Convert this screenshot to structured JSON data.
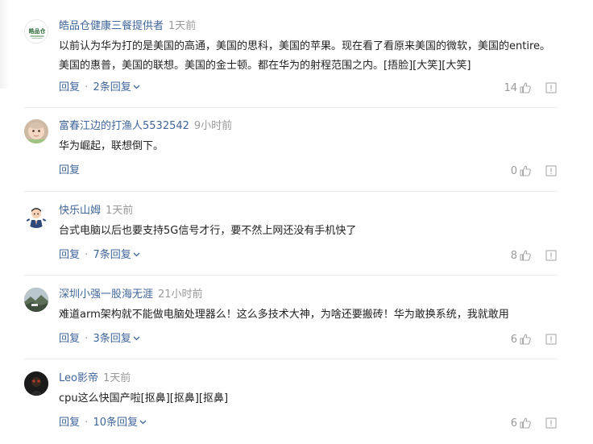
{
  "comments": [
    {
      "username": "皓品仓健康三餐提供者",
      "time": "1天前",
      "text": "以前认为华为打的是美国的高通，美国的思科，美国的苹果。现在看了看原来美国的微软，美国的entire。美国的惠普，美国的联想。美国的金士顿。都在华为的射程范围之内。[捂脸][大笑][大笑]",
      "reply_label": "回复",
      "sep": "·",
      "replies_label": "2条回复",
      "likes": "14",
      "avatar_text": "皓品仓",
      "avatar_icon": "brand-logo-avatar"
    },
    {
      "username": "富春江边的打渔人5532542",
      "time": "9小时前",
      "text": "华为崛起，联想倒下。",
      "reply_label": "回复",
      "likes": "0",
      "avatar_icon": "baby-photo-avatar"
    },
    {
      "username": "快乐山姆",
      "time": "1天前",
      "text": "台式电脑以后也要支持5G信号才行，要不然上网还没有手机快了",
      "reply_label": "回复",
      "sep": "·",
      "replies_label": "7条回复",
      "likes": "8",
      "avatar_icon": "cartoon-man-avatar"
    },
    {
      "username": "深圳小强一股海无涯",
      "time": "21小时前",
      "text": "难道arm架构就不能做电脑处理器么！这么多技术大神，为啥还要搬砖！华为敢换系统，我就敢用",
      "reply_label": "回复",
      "sep": "·",
      "replies_label": "3条回复",
      "likes": "6",
      "avatar_icon": "landscape-photo-avatar"
    },
    {
      "username": "Leo影帝",
      "time": "1天前",
      "text": "cpu这么快国产啦[抠鼻][抠鼻][抠鼻]",
      "reply_label": "回复",
      "sep": "·",
      "replies_label": "10条回复",
      "likes": "6",
      "avatar_icon": "dark-photo-avatar"
    }
  ],
  "colors": {
    "username": "#406599",
    "action": "#406599",
    "muted": "#999999",
    "text": "#222222",
    "divider": "#ececec"
  }
}
